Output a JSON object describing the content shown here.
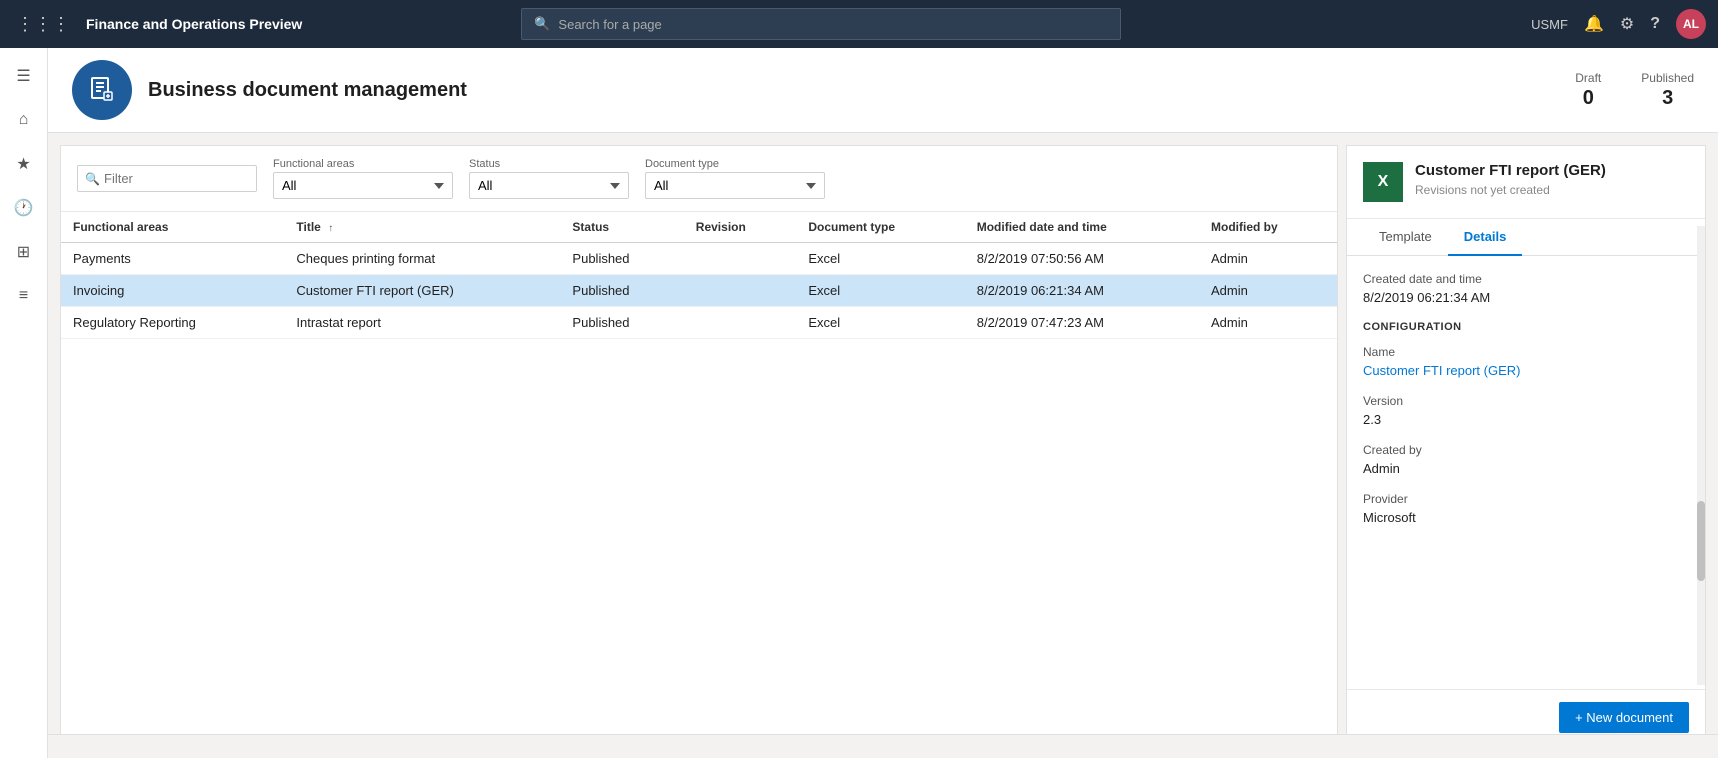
{
  "app": {
    "title": "Finance and Operations Preview",
    "user": "USMF",
    "user_initials": "AL"
  },
  "search": {
    "placeholder": "Search for a page"
  },
  "page": {
    "title": "Business document management",
    "icon": "📋",
    "stats": {
      "draft_label": "Draft",
      "draft_value": "0",
      "published_label": "Published",
      "published_value": "3"
    }
  },
  "filters": {
    "filter_placeholder": "Filter",
    "functional_areas_label": "Functional areas",
    "functional_areas_value": "All",
    "status_label": "Status",
    "status_value": "All",
    "document_type_label": "Document type",
    "document_type_value": "All"
  },
  "table": {
    "columns": [
      "Functional areas",
      "Title",
      "Status",
      "Revision",
      "Document type",
      "Modified date and time",
      "Modified by"
    ],
    "rows": [
      {
        "functional_areas": "Payments",
        "title": "Cheques printing format",
        "status": "Published",
        "revision": "",
        "document_type": "Excel",
        "modified": "8/2/2019 07:50:56 AM",
        "modified_by": "Admin",
        "selected": false
      },
      {
        "functional_areas": "Invoicing",
        "title": "Customer FTI report (GER)",
        "status": "Published",
        "revision": "",
        "document_type": "Excel",
        "modified": "8/2/2019 06:21:34 AM",
        "modified_by": "Admin",
        "selected": true
      },
      {
        "functional_areas": "Regulatory Reporting",
        "title": "Intrastat report",
        "status": "Published",
        "revision": "",
        "document_type": "Excel",
        "modified": "8/2/2019 07:47:23 AM",
        "modified_by": "Admin",
        "selected": false
      }
    ]
  },
  "detail": {
    "title": "Customer FTI report (GER)",
    "subtitle": "Revisions not yet created",
    "tab_template": "Template",
    "tab_details": "Details",
    "fields": {
      "created_label": "Created date and time",
      "created_value": "8/2/2019 06:21:34 AM",
      "configuration_header": "CONFIGURATION",
      "name_label": "Name",
      "name_value": "Customer FTI report (GER)",
      "version_label": "Version",
      "version_value": "2.3",
      "created_by_label": "Created by",
      "created_by_value": "Admin",
      "provider_label": "Provider",
      "provider_value": "Microsoft"
    },
    "new_document_btn": "+ New document"
  },
  "sidebar": {
    "items": [
      {
        "name": "menu-icon",
        "icon": "☰"
      },
      {
        "name": "home-icon",
        "icon": "⌂"
      },
      {
        "name": "favorites-icon",
        "icon": "★"
      },
      {
        "name": "recent-icon",
        "icon": "🕐"
      },
      {
        "name": "modules-icon",
        "icon": "⊞"
      },
      {
        "name": "list-icon",
        "icon": "≡"
      }
    ]
  }
}
